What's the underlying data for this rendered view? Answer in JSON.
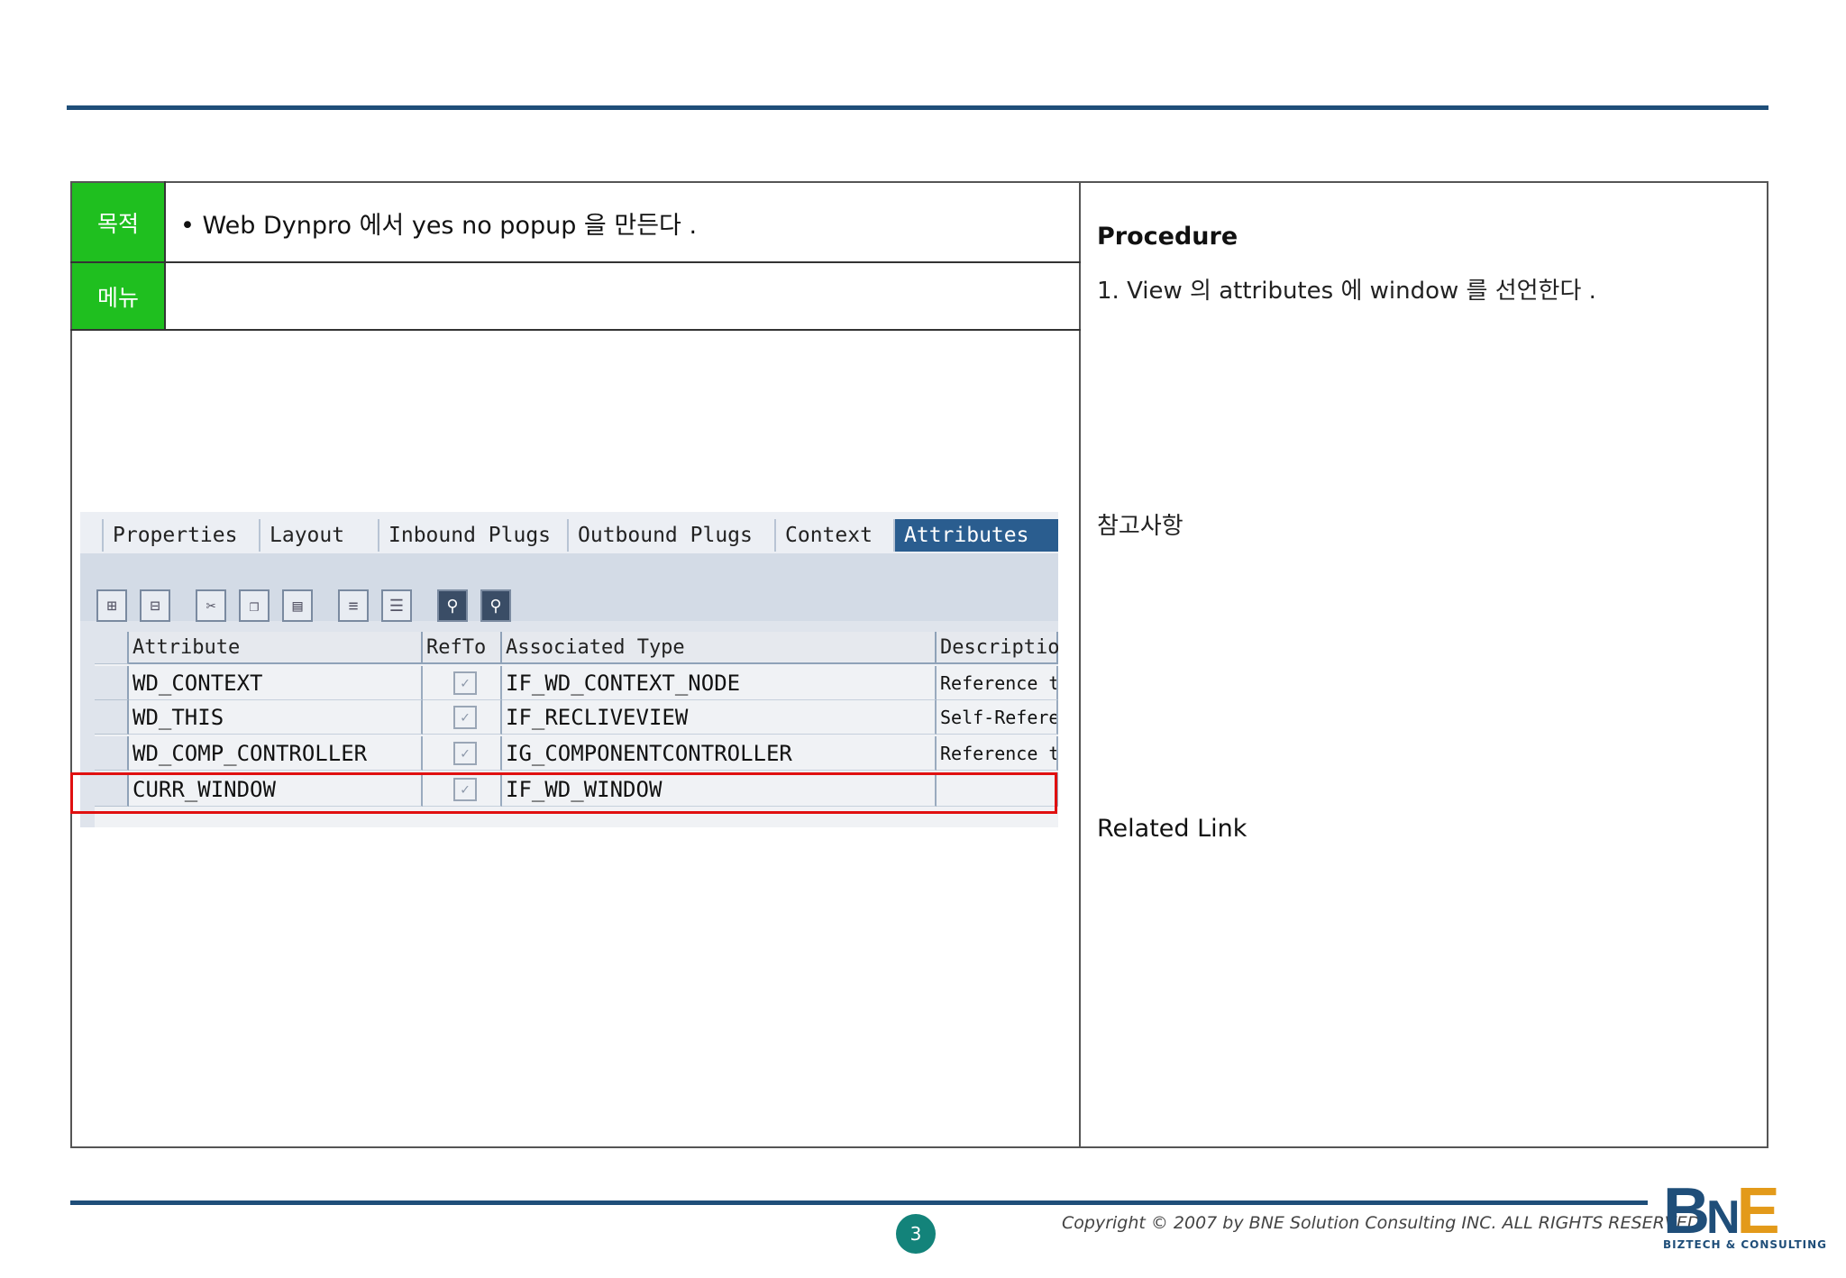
{
  "table": {
    "purpose_label": "목적",
    "purpose_text": "• Web Dynpro  에서  yes no popup 을 만든다 .",
    "menu_label": "메뉴"
  },
  "right": {
    "procedure_title": "Procedure",
    "procedure_step": "1. View 의  attributes 에  window 를 선언한다 .",
    "reference_label": "참고사항",
    "related_label": "Related Link"
  },
  "sap": {
    "tabs": [
      "Properties",
      "Layout",
      "Inbound Plugs",
      "Outbound Plugs",
      "Context",
      "Attributes"
    ],
    "active_tab": "Attributes",
    "toolbar_icons": [
      "insert-row-icon",
      "delete-row-icon",
      "cut-icon",
      "copy-icon",
      "paste-icon",
      "details-icon",
      "list-icon",
      "find-icon",
      "find-next-icon"
    ],
    "columns": [
      "Attribute",
      "RefTo",
      "Associated Type",
      "Description"
    ],
    "rows": [
      {
        "attribute": "WD_CONTEXT",
        "refto": "✓",
        "type": "IF_WD_CONTEXT_NODE",
        "description": "Reference to"
      },
      {
        "attribute": "WD_THIS",
        "refto": "✓",
        "type": "IF_RECLIVEVIEW",
        "description": "Self-Reference"
      },
      {
        "attribute": "WD_COMP_CONTROLLER",
        "refto": "✓",
        "type": "IG_COMPONENTCONTROLLER",
        "description": "Reference to"
      },
      {
        "attribute": "CURR_WINDOW",
        "refto": "✓",
        "type": "IF_WD_WINDOW",
        "description": ""
      }
    ]
  },
  "footer": {
    "page_number": "3",
    "copyright": "Copyright © 2007 by BNE Solution Consulting INC.   ALL RIGHTS RESERVED.",
    "logo_letters": {
      "b": "B",
      "n": "N",
      "e": "E"
    },
    "logo_sub": "BIZTECH & CONSULTING"
  },
  "colors": {
    "label_green": "#1fbf1f",
    "rule_blue": "#1f4e79",
    "highlight_red": "#e01010",
    "page_badge": "#13837a"
  }
}
